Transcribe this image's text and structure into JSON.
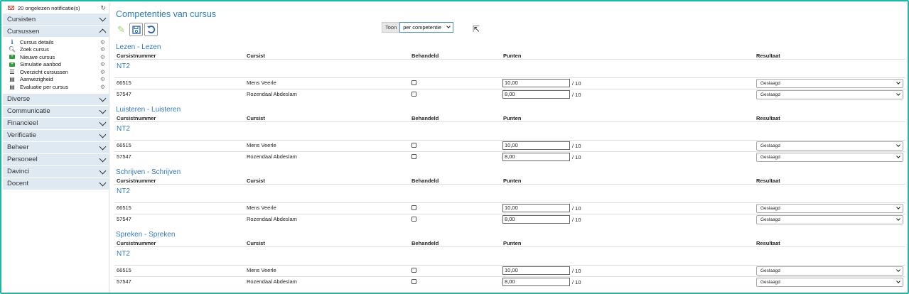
{
  "notifications": {
    "text": "20 ongelezen notificatie(s)",
    "icon": "mail-icon",
    "refresh_icon": "refresh-icon"
  },
  "sidebar": {
    "sections": [
      {
        "label": "Cursisten",
        "expanded": false
      },
      {
        "label": "Cursussen",
        "expanded": true,
        "items": [
          {
            "label": "Cursus details",
            "icon": "info-icon"
          },
          {
            "label": "Zoek cursus",
            "icon": "search-icon"
          },
          {
            "label": "Nieuwe cursus",
            "icon": "add-icon"
          },
          {
            "label": "Simulatie aanbod",
            "icon": "add-icon"
          },
          {
            "label": "Overzicht cursussen",
            "icon": "list-icon"
          },
          {
            "label": "Aanwezigheid",
            "icon": "table-icon"
          },
          {
            "label": "Evaluatie per cursus",
            "icon": "document-icon"
          }
        ]
      },
      {
        "label": "Diverse",
        "expanded": false
      },
      {
        "label": "Communicatie",
        "expanded": false
      },
      {
        "label": "Financieel",
        "expanded": false
      },
      {
        "label": "Verificatie",
        "expanded": false
      },
      {
        "label": "Beheer",
        "expanded": false
      },
      {
        "label": "Personeel",
        "expanded": false
      },
      {
        "label": "Davinci",
        "expanded": false
      },
      {
        "label": "Docent",
        "expanded": false
      }
    ]
  },
  "main": {
    "title": "Competenties van cursus",
    "toolbar": {
      "edit_icon": "pencil-icon",
      "save_icon": "save-icon",
      "undo_icon": "undo-icon"
    },
    "toon": {
      "label": "Toon",
      "selected": "per competentie"
    },
    "columns": [
      "Cursistnummer",
      "Cursist",
      "Behandeld",
      "Punten",
      "Resultaat"
    ],
    "competencies": [
      {
        "title": "Lezen - Lezen",
        "group": "NT2",
        "rows": [
          {
            "number": "66515",
            "name": "Mens Veerle",
            "treated": false,
            "points": "10,00",
            "max": "/ 10",
            "result": "Geslaagd"
          },
          {
            "number": "57547",
            "name": "Rozendaal Abdeslam",
            "treated": false,
            "points": "8,00",
            "max": "/ 10",
            "result": "Geslaagd"
          }
        ]
      },
      {
        "title": "Luisteren - Luisteren",
        "group": "NT2",
        "rows": [
          {
            "number": "66515",
            "name": "Mens Veerle",
            "treated": false,
            "points": "10,00",
            "max": "/ 10",
            "result": "Geslaagd"
          },
          {
            "number": "57547",
            "name": "Rozendaal Abdeslam",
            "treated": false,
            "points": "8,00",
            "max": "/ 10",
            "result": "Geslaagd"
          }
        ]
      },
      {
        "title": "Schrijven - Schrijven",
        "group": "NT2",
        "rows": [
          {
            "number": "66515",
            "name": "Mens Veerle",
            "treated": false,
            "points": "10,00",
            "max": "/ 10",
            "result": "Geslaagd"
          },
          {
            "number": "57547",
            "name": "Rozendaal Abdeslam",
            "treated": false,
            "points": "8,00",
            "max": "/ 10",
            "result": "Geslaagd"
          }
        ]
      },
      {
        "title": "Spreken - Spreken",
        "group": "NT2",
        "rows": [
          {
            "number": "66515",
            "name": "Mens Veerle",
            "treated": false,
            "points": "10,00",
            "max": "/ 10",
            "result": "Geslaagd"
          },
          {
            "number": "57547",
            "name": "Rozendaal Abdeslam",
            "treated": false,
            "points": "8,00",
            "max": "/ 10",
            "result": "Geslaagd"
          }
        ]
      }
    ]
  },
  "colors": {
    "accent": "#2e7bc2",
    "frame": "#22b5a6",
    "sidebar_section_bg": "#dfe9f2",
    "mail": "#e74c3c"
  }
}
